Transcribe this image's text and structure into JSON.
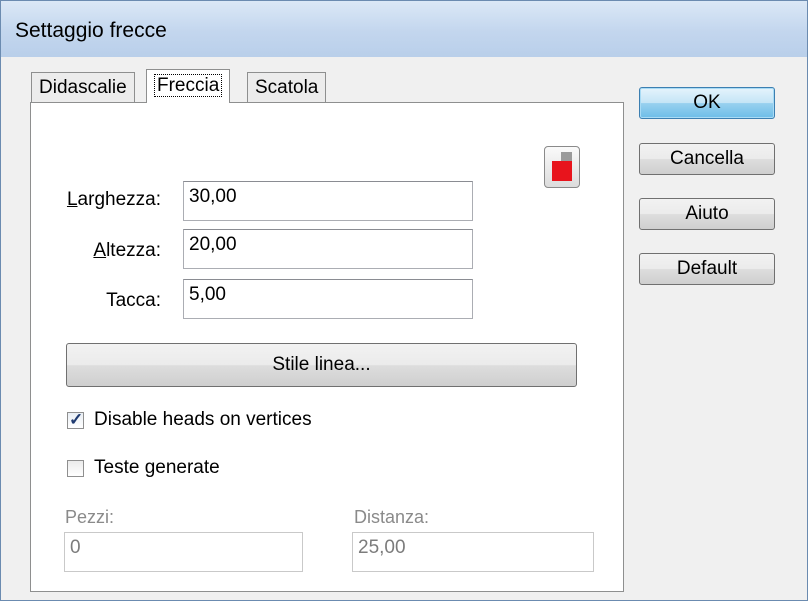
{
  "window": {
    "title": "Settaggio frecce"
  },
  "tabs": [
    {
      "label": "Didascalie",
      "active": false
    },
    {
      "label": "Freccia",
      "active": true
    },
    {
      "label": "Scatola",
      "active": false
    }
  ],
  "buttons": {
    "ok": "OK",
    "cancel": "Cancella",
    "help": "Aiuto",
    "default": "Default"
  },
  "fields": {
    "width": {
      "label_mnemonic": "L",
      "label_rest": "arghezza:",
      "value": "30,00"
    },
    "height": {
      "label_mnemonic": "A",
      "label_rest": "ltezza:",
      "value": "20,00"
    },
    "notch": {
      "label": "Tacca:",
      "value": "5,00"
    }
  },
  "line_style_button": "Stile linea...",
  "color_swatch": {
    "icon": "color-swatch-icon",
    "color": "#e8141c"
  },
  "checkboxes": {
    "disable_heads": {
      "label": "Disable heads on vertices",
      "checked": true
    },
    "generated_heads": {
      "label": "Teste generate",
      "checked": false
    }
  },
  "disabled_fields": {
    "pieces": {
      "label": "Pezzi:",
      "value": "0"
    },
    "distance": {
      "label": "Distanza:",
      "value": "25,00"
    }
  }
}
